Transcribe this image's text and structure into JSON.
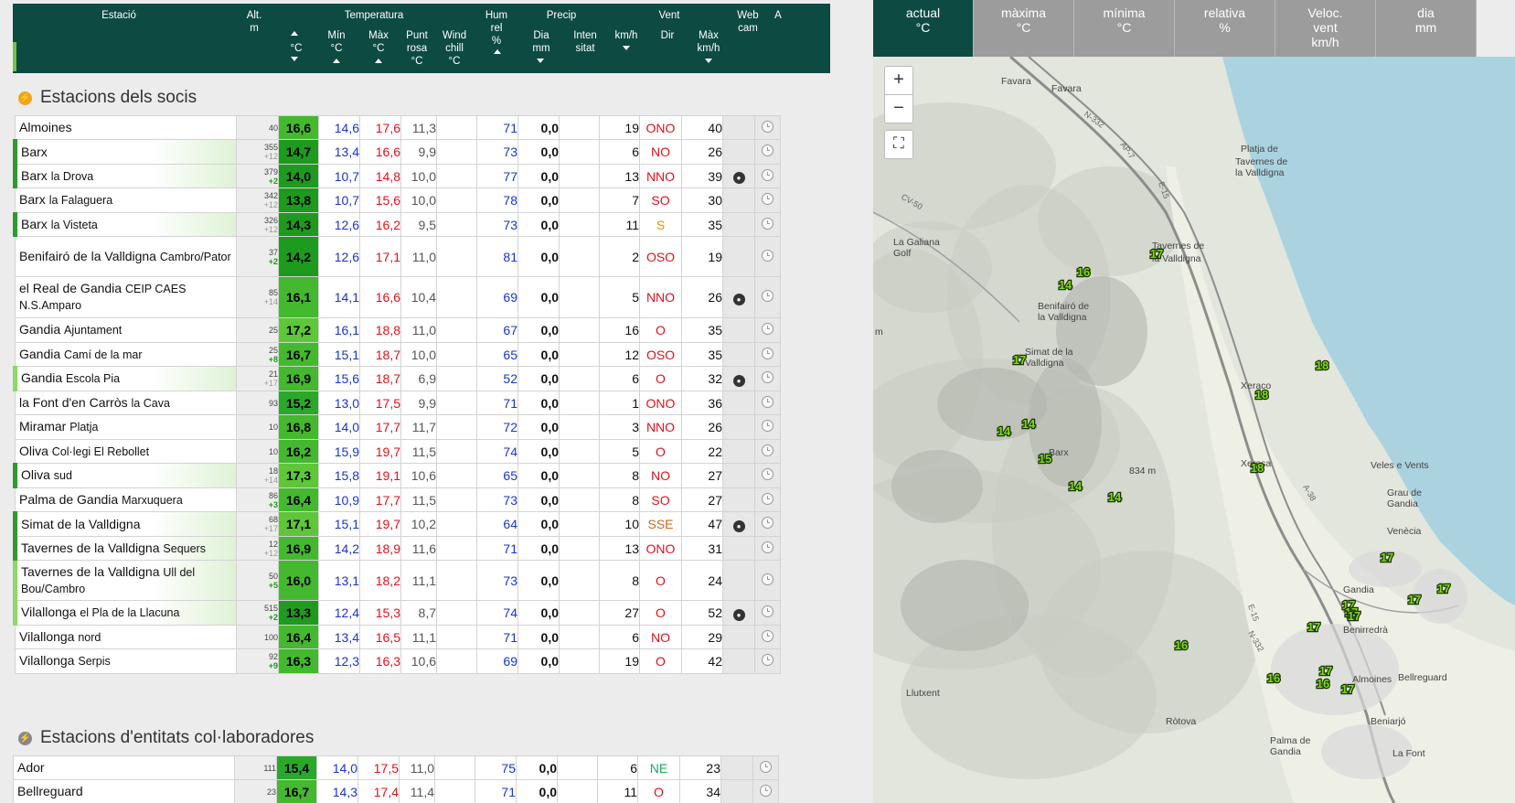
{
  "header": {
    "estacio": "Estació",
    "alt": "Alt.",
    "alt_unit": "m",
    "temperatura": "Temperatura",
    "cur_unit": "°C",
    "min": "Mín",
    "min_unit": "°C",
    "max": "Màx",
    "max_unit": "°C",
    "dew1": "Punt",
    "dew2": "rosa",
    "dew_unit": "°C",
    "wc1": "Wind",
    "wc2": "chill",
    "wc_unit": "°C",
    "hum1": "Hum",
    "hum2": "rel",
    "hum_unit": "%",
    "precip": "Precip",
    "dia": "Dia",
    "dia_unit": "mm",
    "int1": "Inten",
    "int2": "sitat",
    "vent": "Vent",
    "kmh": "km/h",
    "dir": "Dir",
    "vmax": "Màx",
    "vmax_unit": "km/h",
    "web1": "Web",
    "web2": "cam",
    "a": "A"
  },
  "section1_title": "Estacions dels socis",
  "section2_title": "Estacions d'entitats col·laboradores",
  "stations": [
    {
      "name": "Almoines",
      "sub": "",
      "alt": "40",
      "delta": "",
      "cur": "16,6",
      "min": "14,6",
      "max": "17,6",
      "dew": "11,3",
      "wc": "",
      "hum": "71",
      "precip": "0,0",
      "inten": "",
      "spd": "19",
      "dir": "ONO",
      "vmax": "40",
      "cam": false,
      "mark": "none",
      "curcolor": "#44b82e"
    },
    {
      "name": "Barx",
      "sub": "",
      "alt": "355",
      "delta": "+12",
      "cur": "14,7",
      "min": "13,4",
      "max": "16,6",
      "dew": "9,9",
      "wc": "",
      "hum": "73",
      "precip": "0,0",
      "inten": "",
      "spd": "6",
      "dir": "NO",
      "vmax": "26",
      "cam": false,
      "mark": "dark",
      "curcolor": "#1e9a1e"
    },
    {
      "name": "Barx",
      "sub": "la Drova",
      "alt": "379",
      "delta": "+2",
      "cur": "14,0",
      "min": "10,7",
      "max": "14,8",
      "dew": "10,0",
      "wc": "",
      "hum": "77",
      "precip": "0,0",
      "inten": "",
      "spd": "13",
      "dir": "NNO",
      "vmax": "39",
      "cam": true,
      "mark": "dark",
      "curcolor": "#1e9a1e"
    },
    {
      "name": "Barx",
      "sub": "la Falaguera",
      "alt": "342",
      "delta": "+12",
      "cur": "13,8",
      "min": "10,7",
      "max": "15,6",
      "dew": "10,0",
      "wc": "",
      "hum": "78",
      "precip": "0,0",
      "inten": "",
      "spd": "7",
      "dir": "SO",
      "vmax": "30",
      "cam": false,
      "mark": "none",
      "curcolor": "#1e9a1e"
    },
    {
      "name": "Barx",
      "sub": "la Visteta",
      "alt": "326",
      "delta": "+12",
      "cur": "14,3",
      "min": "12,6",
      "max": "16,2",
      "dew": "9,5",
      "wc": "",
      "hum": "73",
      "precip": "0,0",
      "inten": "",
      "spd": "11",
      "dir": "S",
      "vmax": "35",
      "cam": false,
      "mark": "dark",
      "curcolor": "#1e9a1e"
    },
    {
      "name": "Benifairó de la Valldigna",
      "sub": "Cambro/Pator",
      "alt": "37",
      "delta": "+2",
      "cur": "14,2",
      "min": "12,6",
      "max": "17,1",
      "dew": "11,0",
      "wc": "",
      "hum": "81",
      "precip": "0,0",
      "inten": "",
      "spd": "2",
      "dir": "OSO",
      "vmax": "19",
      "cam": false,
      "mark": "none",
      "curcolor": "#1e9a1e"
    },
    {
      "name": "el Real de Gandia",
      "sub": "CEIP CAES N.S.Amparo",
      "alt": "85",
      "delta": "+14",
      "cur": "16,1",
      "min": "14,1",
      "max": "16,6",
      "dew": "10,4",
      "wc": "",
      "hum": "69",
      "precip": "0,0",
      "inten": "",
      "spd": "5",
      "dir": "NNO",
      "vmax": "26",
      "cam": true,
      "mark": "none",
      "curcolor": "#44b82e"
    },
    {
      "name": "Gandia",
      "sub": "Ajuntament",
      "alt": "25",
      "delta": "",
      "cur": "17,2",
      "min": "16,1",
      "max": "18,8",
      "dew": "11,0",
      "wc": "",
      "hum": "67",
      "precip": "0,0",
      "inten": "",
      "spd": "16",
      "dir": "O",
      "vmax": "35",
      "cam": false,
      "mark": "none",
      "curcolor": "#5ec738"
    },
    {
      "name": "Gandia",
      "sub": "Camí de la mar",
      "alt": "25",
      "delta": "+8",
      "cur": "16,7",
      "min": "15,1",
      "max": "18,7",
      "dew": "10,0",
      "wc": "",
      "hum": "65",
      "precip": "0,0",
      "inten": "",
      "spd": "12",
      "dir": "OSO",
      "vmax": "35",
      "cam": false,
      "mark": "none",
      "curcolor": "#44b82e"
    },
    {
      "name": "Gandia",
      "sub": "Escola Pia",
      "alt": "21",
      "delta": "+17",
      "cur": "16,9",
      "min": "15,6",
      "max": "18,7",
      "dew": "6,9",
      "wc": "",
      "hum": "52",
      "precip": "0,0",
      "inten": "",
      "spd": "6",
      "dir": "O",
      "vmax": "32",
      "cam": true,
      "mark": "light",
      "curcolor": "#44b82e"
    },
    {
      "name": "la Font d'en Carròs",
      "sub": "la Cava",
      "alt": "93",
      "delta": "",
      "cur": "15,2",
      "min": "13,0",
      "max": "17,5",
      "dew": "9,9",
      "wc": "",
      "hum": "71",
      "precip": "0,0",
      "inten": "",
      "spd": "1",
      "dir": "ONO",
      "vmax": "36",
      "cam": false,
      "mark": "none",
      "curcolor": "#2aa82a"
    },
    {
      "name": "Miramar",
      "sub": "Platja",
      "alt": "10",
      "delta": "",
      "cur": "16,8",
      "min": "14,0",
      "max": "17,7",
      "dew": "11,7",
      "wc": "",
      "hum": "72",
      "precip": "0,0",
      "inten": "",
      "spd": "3",
      "dir": "NNO",
      "vmax": "26",
      "cam": false,
      "mark": "none",
      "curcolor": "#44b82e"
    },
    {
      "name": "Oliva",
      "sub": "Col·legi El Rebollet",
      "alt": "10",
      "delta": "",
      "cur": "16,2",
      "min": "15,9",
      "max": "19,7",
      "dew": "11,5",
      "wc": "",
      "hum": "74",
      "precip": "0,0",
      "inten": "",
      "spd": "5",
      "dir": "O",
      "vmax": "22",
      "cam": false,
      "mark": "none",
      "curcolor": "#44b82e"
    },
    {
      "name": "Oliva",
      "sub": "sud",
      "alt": "18",
      "delta": "+14",
      "cur": "17,3",
      "min": "15,8",
      "max": "19,1",
      "dew": "10,6",
      "wc": "",
      "hum": "65",
      "precip": "0,0",
      "inten": "",
      "spd": "8",
      "dir": "NO",
      "vmax": "27",
      "cam": false,
      "mark": "dark",
      "curcolor": "#5ec738"
    },
    {
      "name": "Palma de Gandia",
      "sub": "Marxuquera",
      "alt": "86",
      "delta": "+3",
      "cur": "16,4",
      "min": "10,9",
      "max": "17,7",
      "dew": "11,5",
      "wc": "",
      "hum": "73",
      "precip": "0,0",
      "inten": "",
      "spd": "8",
      "dir": "SO",
      "vmax": "27",
      "cam": false,
      "mark": "none",
      "curcolor": "#44b82e"
    },
    {
      "name": "Simat de la Valldigna",
      "sub": "",
      "alt": "68",
      "delta": "+17",
      "cur": "17,1",
      "min": "15,1",
      "max": "19,7",
      "dew": "10,2",
      "wc": "",
      "hum": "64",
      "precip": "0,0",
      "inten": "",
      "spd": "10",
      "dir": "SSE",
      "vmax": "47",
      "cam": true,
      "mark": "dark",
      "curcolor": "#5ec738"
    },
    {
      "name": "Tavernes de la Valldigna",
      "sub": "Sequers",
      "alt": "12",
      "delta": "+12",
      "cur": "16,9",
      "min": "14,2",
      "max": "18,9",
      "dew": "11,6",
      "wc": "",
      "hum": "71",
      "precip": "0,0",
      "inten": "",
      "spd": "13",
      "dir": "ONO",
      "vmax": "31",
      "cam": false,
      "mark": "dark",
      "curcolor": "#44b82e"
    },
    {
      "name": "Tavernes de la Valldigna",
      "sub": "Ull del Bou/Cambro",
      "alt": "50",
      "delta": "+5",
      "cur": "16,0",
      "min": "13,1",
      "max": "18,2",
      "dew": "11,1",
      "wc": "",
      "hum": "73",
      "precip": "0,0",
      "inten": "",
      "spd": "8",
      "dir": "O",
      "vmax": "24",
      "cam": false,
      "mark": "light",
      "curcolor": "#44b82e"
    },
    {
      "name": "Vilallonga",
      "sub": "el Pla de la Llacuna",
      "alt": "515",
      "delta": "+2",
      "cur": "13,3",
      "min": "12,4",
      "max": "15,3",
      "dew": "8,7",
      "wc": "",
      "hum": "74",
      "precip": "0,0",
      "inten": "",
      "spd": "27",
      "dir": "O",
      "vmax": "52",
      "cam": true,
      "mark": "light",
      "curcolor": "#1e9a1e"
    },
    {
      "name": "Vilallonga",
      "sub": "nord",
      "alt": "100",
      "delta": "",
      "cur": "16,4",
      "min": "13,4",
      "max": "16,5",
      "dew": "11,1",
      "wc": "",
      "hum": "71",
      "precip": "0,0",
      "inten": "",
      "spd": "6",
      "dir": "NO",
      "vmax": "29",
      "cam": false,
      "mark": "none",
      "curcolor": "#44b82e"
    },
    {
      "name": "Vilallonga",
      "sub": "Serpis",
      "alt": "92",
      "delta": "+9",
      "cur": "16,3",
      "min": "12,3",
      "max": "16,3",
      "dew": "10,6",
      "wc": "",
      "hum": "69",
      "precip": "0,0",
      "inten": "",
      "spd": "19",
      "dir": "O",
      "vmax": "42",
      "cam": false,
      "mark": "none",
      "curcolor": "#44b82e"
    }
  ],
  "stations2": [
    {
      "name": "Ador",
      "sub": "",
      "alt": "111",
      "delta": "",
      "cur": "15,4",
      "min": "14,0",
      "max": "17,5",
      "dew": "11,0",
      "wc": "",
      "hum": "75",
      "precip": "0,0",
      "inten": "",
      "spd": "6",
      "dir": "NE",
      "vmax": "23",
      "cam": false,
      "mark": "none",
      "curcolor": "#2aa82a"
    },
    {
      "name": "Bellreguard",
      "sub": "",
      "alt": "23",
      "delta": "",
      "cur": "16,7",
      "min": "14,3",
      "max": "17,4",
      "dew": "11,4",
      "wc": "",
      "hum": "71",
      "precip": "0,0",
      "inten": "",
      "spd": "11",
      "dir": "O",
      "vmax": "34",
      "cam": false,
      "mark": "none",
      "curcolor": "#44b82e"
    }
  ],
  "dir_colors": {
    "ONO": "#e0101a",
    "NO": "#e0101a",
    "NNO": "#e0101a",
    "SO": "#e0101a",
    "OSO": "#e0101a",
    "O": "#e0101a",
    "S": "#f08a00",
    "SSE": "#d0651a",
    "NE": "#1aa85a"
  },
  "map_tabs": [
    {
      "l1": "actual",
      "l2": "°C",
      "l3": ""
    },
    {
      "l1": "màxima",
      "l2": "°C",
      "l3": ""
    },
    {
      "l1": "mínima",
      "l2": "°C",
      "l3": ""
    },
    {
      "l1": "relativa",
      "l2": "%",
      "l3": ""
    },
    {
      "l1": "Veloc.",
      "l2": "vent",
      "l3": "km/h"
    },
    {
      "l1": "dia",
      "l2": "mm",
      "l3": ""
    }
  ],
  "map": {
    "zoom_in": "+",
    "zoom_out": "−",
    "fullscreen": "⛶",
    "places": [
      {
        "text": "Favara"
      },
      {
        "text": "Platja de"
      },
      {
        "text": "Tavernes de"
      },
      {
        "text": "la Valldigna"
      },
      {
        "text": "Tavernes de"
      },
      {
        "text": "la Valldigna"
      },
      {
        "text": "La Galiana"
      },
      {
        "text": "Golf"
      },
      {
        "text": "Benifairó de"
      },
      {
        "text": "la Valldigna"
      },
      {
        "text": "Simat de la"
      },
      {
        "text": "Valldigna"
      },
      {
        "text": "Xeraco"
      },
      {
        "text": "Xeresa"
      },
      {
        "text": "Barx"
      },
      {
        "text": "834 m"
      },
      {
        "text": "Veles e Vents"
      },
      {
        "text": "Grau de"
      },
      {
        "text": "Gandia"
      },
      {
        "text": "Venècia"
      },
      {
        "text": "Gandia"
      },
      {
        "text": "Benirredrà"
      },
      {
        "text": "Almoines"
      },
      {
        "text": "Bellreguard"
      },
      {
        "text": "Beniarjó"
      },
      {
        "text": "Llutxent"
      },
      {
        "text": "Ròtova"
      },
      {
        "text": "Palma de"
      },
      {
        "text": "Gandia"
      },
      {
        "text": "La Font"
      },
      {
        "text": "Favara"
      },
      {
        "text": "m"
      }
    ],
    "roads": [
      {
        "text": "N-332"
      },
      {
        "text": "AP-7"
      },
      {
        "text": "E-15"
      },
      {
        "text": "CV-50"
      },
      {
        "text": "A-38"
      },
      {
        "text": "E-15"
      },
      {
        "text": "N-332"
      }
    ],
    "markers": [
      {
        "t": "17"
      },
      {
        "t": "16"
      },
      {
        "t": "14"
      },
      {
        "t": "17"
      },
      {
        "t": "18"
      },
      {
        "t": "18"
      },
      {
        "t": "14"
      },
      {
        "t": "14"
      },
      {
        "t": "15"
      },
      {
        "t": "18"
      },
      {
        "t": "14"
      },
      {
        "t": "14"
      },
      {
        "t": "17"
      },
      {
        "t": "17"
      },
      {
        "t": "17"
      },
      {
        "t": "17"
      },
      {
        "t": "17"
      },
      {
        "t": "17"
      },
      {
        "t": "16"
      },
      {
        "t": "16"
      },
      {
        "t": "17"
      },
      {
        "t": "17"
      },
      {
        "t": "17"
      },
      {
        "t": "16"
      }
    ]
  }
}
